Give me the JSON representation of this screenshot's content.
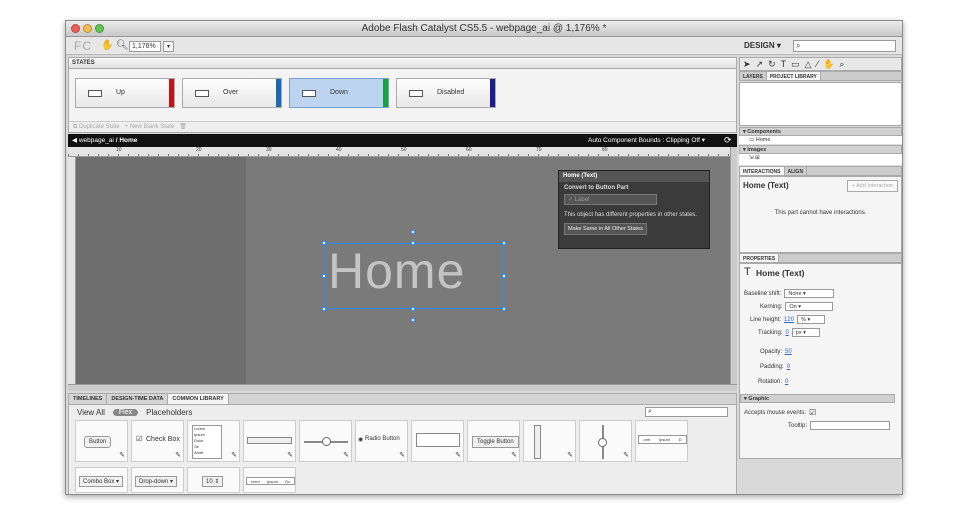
{
  "window": {
    "title": "Adobe Flash Catalyst CS5.5 - webpage_ai @ 1,176% *"
  },
  "toolbar": {
    "logo": "FC",
    "zoom": "1,176%",
    "workspace": "DESIGN",
    "search_placeholder": ""
  },
  "states": {
    "header": "STATES",
    "items": [
      {
        "label": "Up",
        "color": "#c0141b"
      },
      {
        "label": "Over",
        "color": "#1c67b1"
      },
      {
        "label": "Down",
        "color": "#15a43a"
      },
      {
        "label": "Disabled",
        "color": "#1a1c8f"
      }
    ],
    "duplicate": "Duplicate State",
    "new_blank": "New Blank State"
  },
  "canvas": {
    "breadcrumb_root": "webpage_ai",
    "breadcrumb_current": "Home",
    "bounds_label": "Auto Component Bounds : Clipping Off",
    "ruler_ticks": [
      "10",
      "20",
      "30",
      "40",
      "50",
      "60",
      "70",
      "80"
    ],
    "text": "Home"
  },
  "hud": {
    "title": "Home (Text)",
    "convert": "Convert to Button Part",
    "option": "Label",
    "note": "This object has different properties in other states.",
    "button": "Make Same in All Other States"
  },
  "library": {
    "tabs": [
      "TIMELINES",
      "DESIGN-TIME DATA",
      "COMMON LIBRARY"
    ],
    "view_all": "View All",
    "flex": "Flex",
    "placeholders": "Placeholders",
    "items": [
      "Button",
      "Check Box",
      "",
      "",
      "",
      "Radio Button",
      "",
      "Toggle Button",
      "",
      "",
      ""
    ],
    "items_row2": [
      "Combo Box",
      "Drop-down",
      "10",
      ""
    ],
    "list_rows": [
      "Lorem",
      "Ipsum",
      "Dolor",
      "Sit",
      "Amet"
    ],
    "tab_labels": [
      "orm",
      "Ipsum",
      "D"
    ],
    "tab_labels2": [
      "orem",
      "Ipsum",
      "Do"
    ]
  },
  "panels": {
    "tabs": [
      "LAYERS",
      "PROJECT LIBRARY"
    ],
    "components": "Components",
    "component_item": "Home",
    "images": "Images",
    "inter_tabs": [
      "INTERACTIONS",
      "ALIGN"
    ],
    "inter_title": "Home (Text)",
    "add_interaction": "Add Interaction",
    "no_interactions": "This part cannot have interactions.",
    "props_tab": "PROPERTIES",
    "props_title": "Home (Text)",
    "baseline_label": "Baseline shift:",
    "baseline_value": "None",
    "kerning_label": "Kerning:",
    "kerning_value": "On",
    "lineheight_label": "Line height:",
    "lineheight_value": "120",
    "lineheight_unit": "%",
    "tracking_label": "Tracking:",
    "tracking_value": "0",
    "tracking_unit": "px",
    "opacity_label": "Opacity:",
    "opacity_value": "50",
    "padding_label": "Padding:",
    "padding_value": "0",
    "rotation_label": "Rotation:",
    "rotation_value": "0",
    "graphic": "Graphic",
    "mouse_label": "Accepts mouse events:",
    "tooltip_label": "Tooltip:"
  }
}
